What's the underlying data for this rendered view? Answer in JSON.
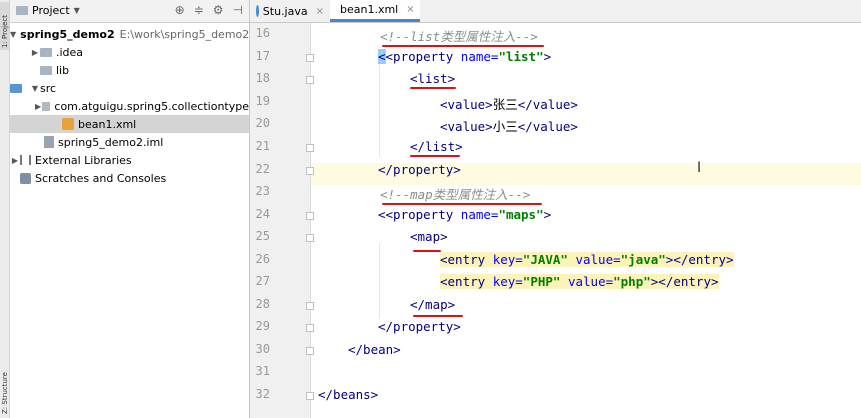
{
  "tool_strip": {
    "project_tab": "1: Project",
    "structure_tab": "Z: Structure"
  },
  "project_panel": {
    "title": "Project",
    "tree": [
      {
        "label": "spring5_demo2",
        "path": "E:\\work\\spring5_demo2",
        "bold": true
      },
      {
        "label": ".idea"
      },
      {
        "label": "lib"
      },
      {
        "label": "src"
      },
      {
        "label": "com.atguigu.spring5.collectiontype"
      },
      {
        "label": "bean1.xml"
      },
      {
        "label": "spring5_demo2.iml"
      },
      {
        "label": "External Libraries"
      },
      {
        "label": "Scratches and Consoles"
      }
    ]
  },
  "editor": {
    "tabs": [
      {
        "label": "Stu.java",
        "active": false
      },
      {
        "label": "bean1.xml",
        "active": true
      }
    ],
    "lines": [
      {
        "num": "16",
        "comment": "<!--list类型属性注入-->"
      },
      {
        "num": "17",
        "open": "<property ",
        "a1": "name=",
        "v1": "\"list\"",
        "close": ">"
      },
      {
        "num": "18",
        "tag": "<list>"
      },
      {
        "num": "19",
        "tag_a": "<value>",
        "text": "张三",
        "tag_b": "</value>"
      },
      {
        "num": "20",
        "tag_a": "<value>",
        "text": "小三",
        "tag_b": "</value>"
      },
      {
        "num": "21",
        "tag": "</list>"
      },
      {
        "num": "22",
        "tag": "</property>"
      },
      {
        "num": "23",
        "comment": "<!--map类型属性注入-->"
      },
      {
        "num": "24",
        "open": "<property ",
        "a1": "name=",
        "v1": "\"maps\"",
        "close": ">"
      },
      {
        "num": "25",
        "tag": "<map>"
      },
      {
        "num": "26",
        "e_open": "<entry ",
        "k": "key=",
        "kv": "\"JAVA\"",
        "v": " value=",
        "vv": "\"java\"",
        "e_close": "></entry>"
      },
      {
        "num": "27",
        "e_open": "<entry ",
        "k": "key=",
        "kv": "\"PHP\"",
        "v": " value=",
        "vv": "\"php\"",
        "e_close": "></entry>"
      },
      {
        "num": "28",
        "tag": "</map>"
      },
      {
        "num": "29",
        "tag": "</property>"
      },
      {
        "num": "30",
        "tag": "</bean>"
      },
      {
        "num": "31"
      },
      {
        "num": "32",
        "tag": "</beans>"
      }
    ]
  },
  "colors": {
    "tag": "#000080",
    "attribute": "#0000ff",
    "attribute_value": "#008000",
    "comment": "#8c8c8c",
    "annotation_underline": "#e01010",
    "current_line": "#fffbe0"
  }
}
